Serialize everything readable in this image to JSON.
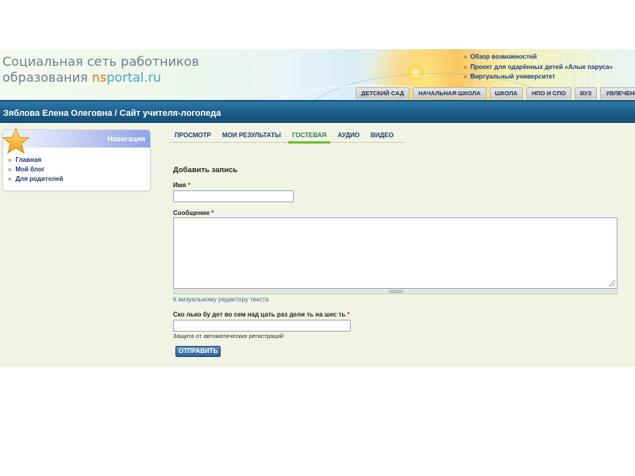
{
  "header": {
    "logo_line1": "Социальная сеть работников",
    "logo_line2_prefix": "образования ",
    "logo_ns": "ns",
    "logo_portal": "portal.ru",
    "top_links": [
      {
        "bullet": "»",
        "label": "Обзор возможностей"
      },
      {
        "bullet": "»",
        "label": "Проект для одарённых детей «Алые паруса»"
      },
      {
        "bullet": "»",
        "label": "Виртуальный университет"
      }
    ],
    "tabs": [
      "ДЕТСКИЙ САД",
      "НАЧАЛЬНАЯ ШКОЛА",
      "ШКОЛА",
      "НПО И СПО",
      "ВУЗ",
      "УВЛЕЧЕНИЯ"
    ]
  },
  "site_title": "Зяблова Елена Олеговна / Сайт учителя-логопеда",
  "sidebar": {
    "title": "Навигация",
    "items": [
      {
        "bullet": "»",
        "label": "Главная"
      },
      {
        "bullet": "»",
        "label": "Мой блог"
      },
      {
        "bullet": "»",
        "label": "Для родителей"
      }
    ]
  },
  "subtabs": [
    {
      "label": "ПРОСМОТР",
      "active": false
    },
    {
      "label": "МОИ РЕЗУЛЬТАТЫ",
      "active": false
    },
    {
      "label": "ГОСТЕВАЯ",
      "active": true
    },
    {
      "label": "АУДИО",
      "active": false
    },
    {
      "label": "ВИДЕО",
      "active": false
    }
  ],
  "form": {
    "title": "Добавить запись",
    "name_label": "Имя",
    "name_value": "",
    "message_label": "Сообщение",
    "message_value": "",
    "required_mark": "*",
    "editor_link": "К визуальному редактору текста",
    "captcha_label": "Ско лько бу дет во сем над цать раз дели ть на шес ть",
    "captcha_value": "",
    "captcha_hint": "Защита от автоматических регистраций",
    "submit_label": "ОТПРАВИТЬ"
  },
  "colors": {
    "title_bar": "#1b5a86",
    "content_bg": "#f1f4e5",
    "link_dark": "#1c3b70",
    "bullet": "#c85a20",
    "active_tab_underline": "#79b93f",
    "required": "#d0201a",
    "logo_ns": "#e0721e",
    "logo_portal": "#4aa5c6"
  }
}
